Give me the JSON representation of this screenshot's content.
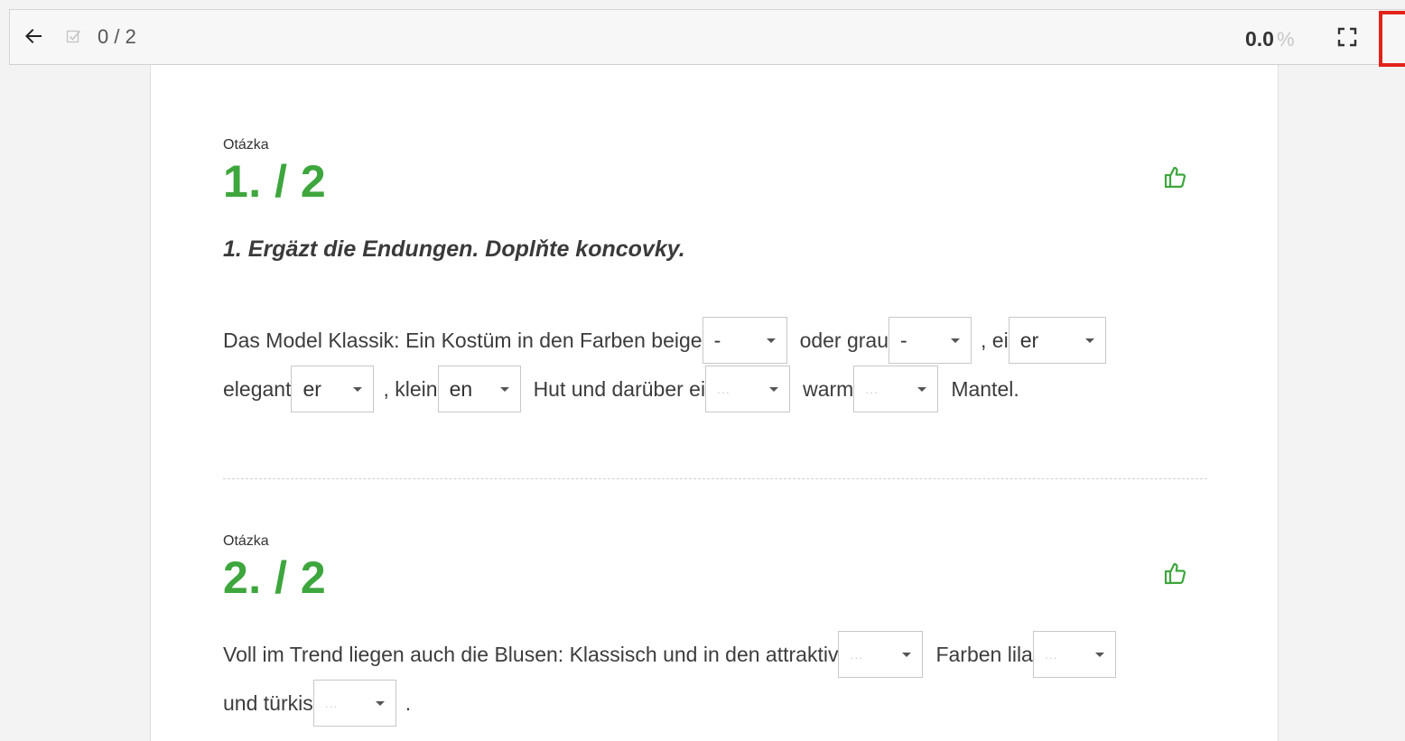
{
  "topbar": {
    "progress": "0 / 2",
    "score_value": "0.0",
    "score_unit": "%"
  },
  "questions": [
    {
      "label": "Otázka",
      "number": "1. / 2",
      "title": "1. Ergäzt die Endungen. Doplňte koncovky.",
      "lines": [
        {
          "parts": [
            {
              "type": "text",
              "text": "Das Model Klassik: Ein Kostüm in den Farben beige"
            },
            {
              "type": "select",
              "value": "-"
            },
            {
              "type": "text",
              "text": "oder grau"
            },
            {
              "type": "select",
              "value": "-"
            },
            {
              "type": "text",
              "text": ", ei"
            },
            {
              "type": "select",
              "value": "er"
            }
          ]
        },
        {
          "parts": [
            {
              "type": "text",
              "text": "elegant"
            },
            {
              "type": "select",
              "value": "er"
            },
            {
              "type": "text",
              "text": ", klein"
            },
            {
              "type": "select",
              "value": "en"
            },
            {
              "type": "text",
              "text": "Hut und darüber ei"
            },
            {
              "type": "select",
              "value": "..."
            },
            {
              "type": "text",
              "text": "warm"
            },
            {
              "type": "select",
              "value": "..."
            },
            {
              "type": "text",
              "text": "Mantel."
            }
          ]
        }
      ]
    },
    {
      "label": "Otázka",
      "number": "2. / 2",
      "title": "",
      "lines": [
        {
          "parts": [
            {
              "type": "text",
              "text": "Voll im Trend liegen auch die Blusen: Klassisch und in den attraktiv"
            },
            {
              "type": "select",
              "value": "..."
            },
            {
              "type": "text",
              "text": "Farben lila"
            },
            {
              "type": "select",
              "value": "..."
            }
          ]
        },
        {
          "parts": [
            {
              "type": "text",
              "text": "und türkis"
            },
            {
              "type": "select",
              "value": "..."
            },
            {
              "type": "text",
              "text": "."
            }
          ]
        }
      ]
    }
  ],
  "icons": {
    "back": "arrow-left-icon",
    "check": "checkbox-check-icon",
    "fullscreen": "fullscreen-icon",
    "menu": "vertical-dots-icon",
    "thumb": "thumbs-up-icon"
  },
  "colors": {
    "accent_green": "#3da63d",
    "highlight_red": "#e2231a"
  }
}
